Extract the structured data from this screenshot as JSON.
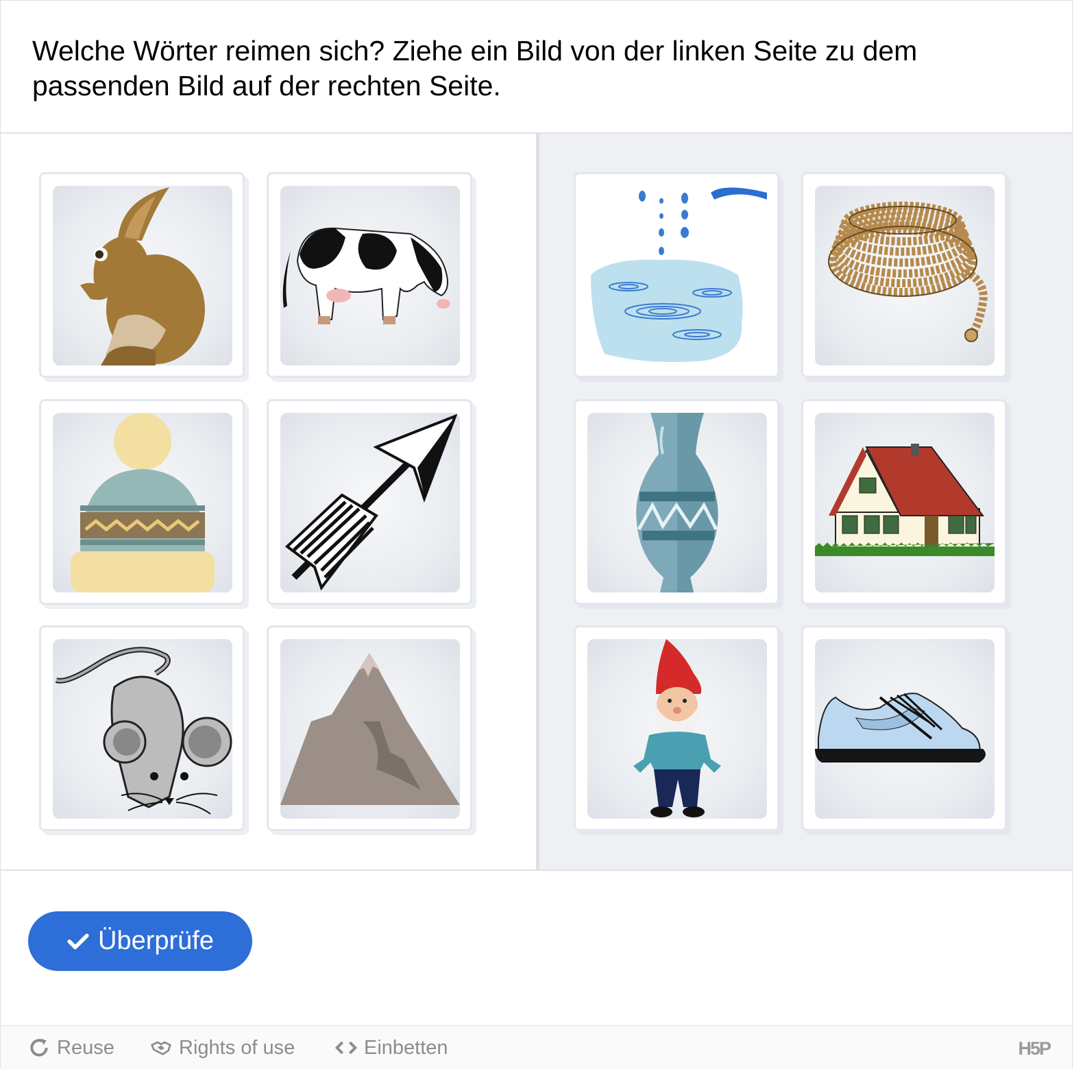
{
  "task": {
    "text": "Welche Wörter reimen sich? Ziehe ein Bild von der linken Seite zu dem passenden Bild auf der rechten Seite."
  },
  "left_cards": [
    {
      "icon": "rabbit-icon"
    },
    {
      "icon": "cow-icon"
    },
    {
      "icon": "beanie-hat-icon"
    },
    {
      "icon": "arrow-icon"
    },
    {
      "icon": "mouse-icon"
    },
    {
      "icon": "mountain-icon"
    }
  ],
  "right_cards": [
    {
      "icon": "puddle-icon"
    },
    {
      "icon": "rope-icon"
    },
    {
      "icon": "vase-icon"
    },
    {
      "icon": "house-icon"
    },
    {
      "icon": "garden-gnome-icon"
    },
    {
      "icon": "sneaker-icon"
    }
  ],
  "check_button": {
    "label": "Überprüfe",
    "color": "#2d6ed8"
  },
  "footer": {
    "reuse": "Reuse",
    "rights": "Rights of use",
    "embed": "Einbetten",
    "logo": "H5P"
  }
}
